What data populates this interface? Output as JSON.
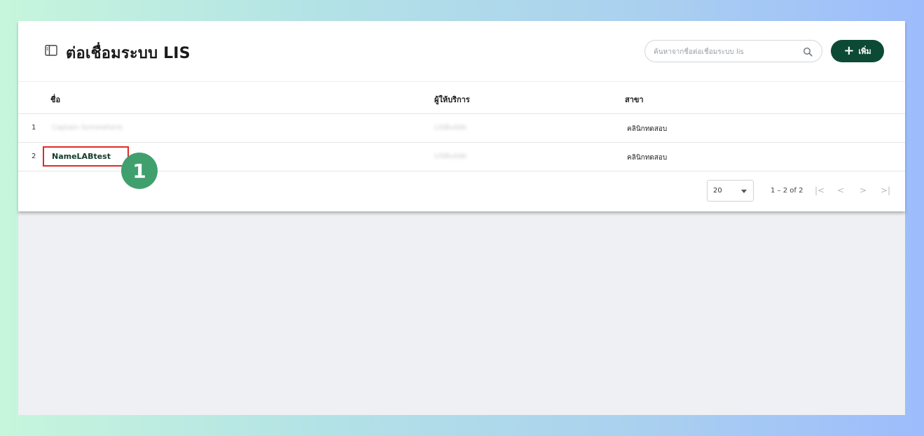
{
  "header": {
    "title": "ต่อเชื่อมระบบ LIS",
    "search_placeholder": "ค้นหาจากชื่อต่อเชื่อมระบบ lis",
    "add_label": "เพิ่ม",
    "add_symbol": "+"
  },
  "table": {
    "columns": [
      "ชื่อ",
      "ผู้ให้บริการ",
      "สาขา"
    ],
    "rows": [
      {
        "index": "1",
        "name": "Captain Somewhere",
        "provider": "LISBuilde",
        "branch": "คลินิกทดสอบ"
      },
      {
        "index": "2",
        "name": "NameLABtest",
        "provider": "LISBuilde",
        "branch": "คลินิกทดสอบ"
      }
    ]
  },
  "paginator": {
    "page_size": "20",
    "range": "1 – 2 of 2",
    "first": "|<",
    "prev": "<",
    "next": ">",
    "last": ">|"
  },
  "annotation": {
    "step": "1"
  },
  "colors": {
    "accent": "#0d4a35",
    "highlight": "#e02a2a",
    "badge": "#3fa06e"
  }
}
